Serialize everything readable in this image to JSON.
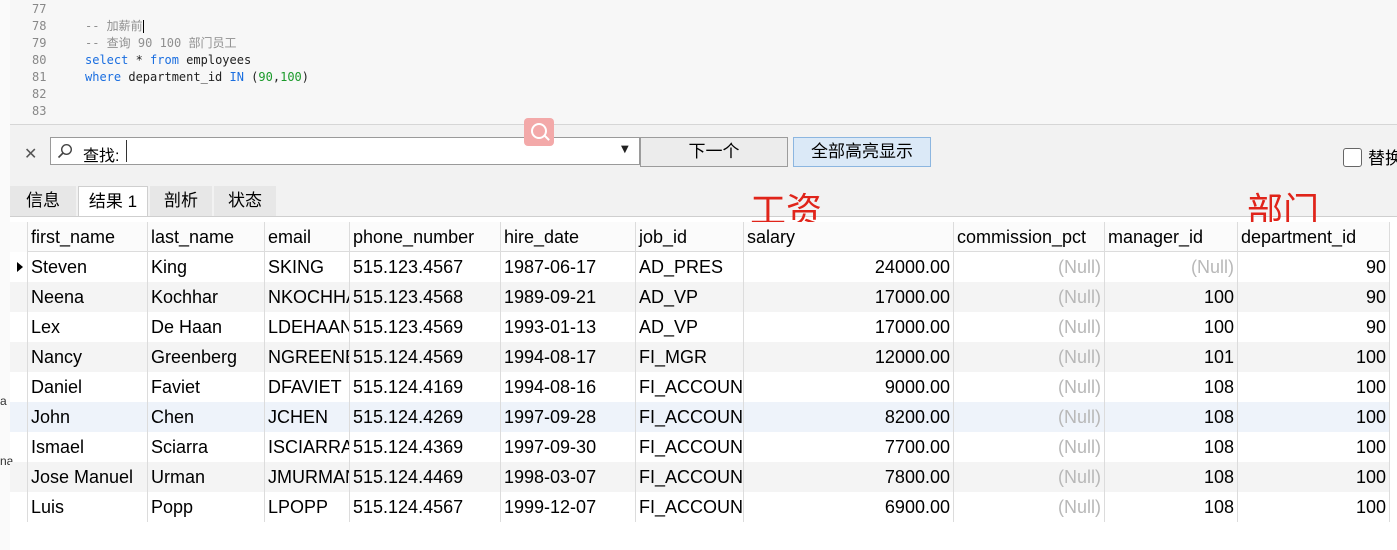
{
  "editor": {
    "lines": [
      {
        "no": "77",
        "tokens": []
      },
      {
        "no": "78",
        "tokens": [
          {
            "t": "comment",
            "v": "-- 加薪前"
          }
        ],
        "caret": true
      },
      {
        "no": "79",
        "tokens": [
          {
            "t": "comment",
            "v": "-- 查询 90 100 部门员工"
          }
        ]
      },
      {
        "no": "80",
        "tokens": [
          {
            "t": "kw",
            "v": "select"
          },
          {
            "t": "plain",
            "v": " * "
          },
          {
            "t": "kw",
            "v": "from"
          },
          {
            "t": "plain",
            "v": " employees"
          }
        ]
      },
      {
        "no": "81",
        "tokens": [
          {
            "t": "kw",
            "v": "where"
          },
          {
            "t": "plain",
            "v": " department_id "
          },
          {
            "t": "kw",
            "v": "IN"
          },
          {
            "t": "plain",
            "v": " ("
          },
          {
            "t": "num",
            "v": "90"
          },
          {
            "t": "plain",
            "v": ","
          },
          {
            "t": "num",
            "v": "100"
          },
          {
            "t": "plain",
            "v": ")"
          }
        ]
      },
      {
        "no": "82",
        "tokens": []
      },
      {
        "no": "83",
        "tokens": []
      }
    ]
  },
  "left_strip": {
    "letter1": "a",
    "letter2": "na"
  },
  "find": {
    "close_icon": "close-icon",
    "search_icon": "magnifier-icon",
    "label": "查找:",
    "value": "",
    "next_label": "下一个",
    "highlight_all_label": "全部高亮显示",
    "replace_label": "替换"
  },
  "tabs": [
    {
      "label": "信息",
      "active": false
    },
    {
      "label": "结果 1",
      "active": true
    },
    {
      "label": "剖析",
      "active": false
    },
    {
      "label": "状态",
      "active": false
    }
  ],
  "annotations": {
    "salary_note": "工资",
    "dept_note": "部门",
    "color": "#e0241a"
  },
  "grid": {
    "columns": [
      "first_name",
      "last_name",
      "email",
      "phone_number",
      "hire_date",
      "job_id",
      "salary",
      "commission_pct",
      "manager_id",
      "department_id"
    ],
    "rows": [
      [
        "Steven",
        "King",
        "SKING",
        "515.123.4567",
        "1987-06-17",
        "AD_PRES",
        "24000.00",
        "(Null)",
        "(Null)",
        "90"
      ],
      [
        "Neena",
        "Kochhar",
        "NKOCHHAR",
        "515.123.4568",
        "1989-09-21",
        "AD_VP",
        "17000.00",
        "(Null)",
        "100",
        "90"
      ],
      [
        "Lex",
        "De Haan",
        "LDEHAAN",
        "515.123.4569",
        "1993-01-13",
        "AD_VP",
        "17000.00",
        "(Null)",
        "100",
        "90"
      ],
      [
        "Nancy",
        "Greenberg",
        "NGREENBE",
        "515.124.4569",
        "1994-08-17",
        "FI_MGR",
        "12000.00",
        "(Null)",
        "101",
        "100"
      ],
      [
        "Daniel",
        "Faviet",
        "DFAVIET",
        "515.124.4169",
        "1994-08-16",
        "FI_ACCOUNT",
        "9000.00",
        "(Null)",
        "108",
        "100"
      ],
      [
        "John",
        "Chen",
        "JCHEN",
        "515.124.4269",
        "1997-09-28",
        "FI_ACCOUNT",
        "8200.00",
        "(Null)",
        "108",
        "100"
      ],
      [
        "Ismael",
        "Sciarra",
        "ISCIARRA",
        "515.124.4369",
        "1997-09-30",
        "FI_ACCOUNT",
        "7700.00",
        "(Null)",
        "108",
        "100"
      ],
      [
        "Jose Manuel",
        "Urman",
        "JMURMAN",
        "515.124.4469",
        "1998-03-07",
        "FI_ACCOUNT",
        "7800.00",
        "(Null)",
        "108",
        "100"
      ],
      [
        "Luis",
        "Popp",
        "LPOPP",
        "515.124.4567",
        "1999-12-07",
        "FI_ACCOUNT",
        "6900.00",
        "(Null)",
        "108",
        "100"
      ]
    ],
    "selected_row": 0
  }
}
